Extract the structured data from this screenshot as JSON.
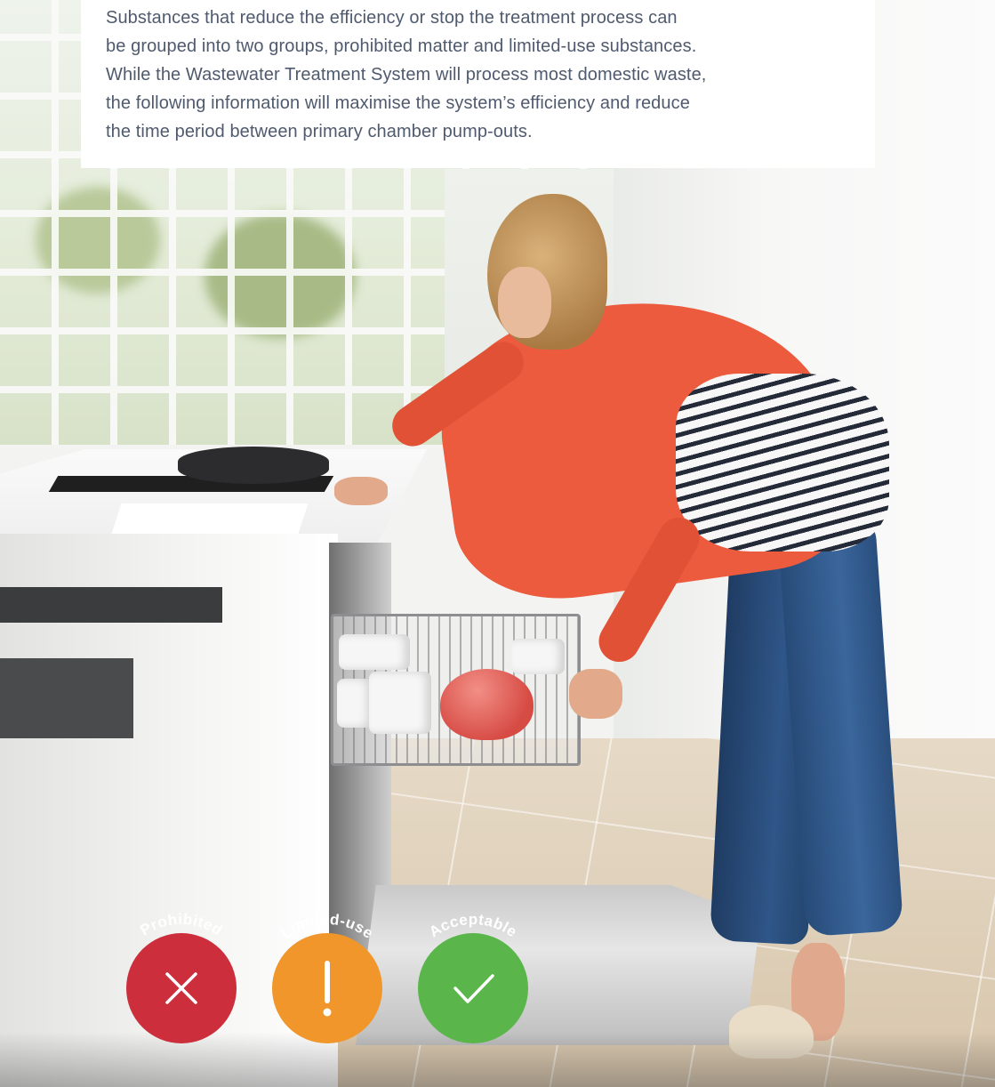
{
  "intro": {
    "lines": [
      "Substances that reduce the efficiency or stop the treatment process can",
      "be grouped into two groups, prohibited matter and limited-use substances.",
      "While the Wastewater Treatment System will process most domestic waste,",
      "the following information will maximise the system’s efficiency and reduce",
      "the time period between primary chamber pump-outs."
    ]
  },
  "legend": {
    "prohibited": {
      "label": "Prohibited",
      "icon": "cross-icon",
      "color": "#cc2e3c"
    },
    "limited": {
      "label": "Limited-use",
      "icon": "exclamation-icon",
      "color": "#f0962a"
    },
    "acceptable": {
      "label": "Acceptable",
      "icon": "check-icon",
      "color": "#5ab64b"
    }
  },
  "colors": {
    "text": "#4f5a6e",
    "panel_background": "#ffffff"
  }
}
